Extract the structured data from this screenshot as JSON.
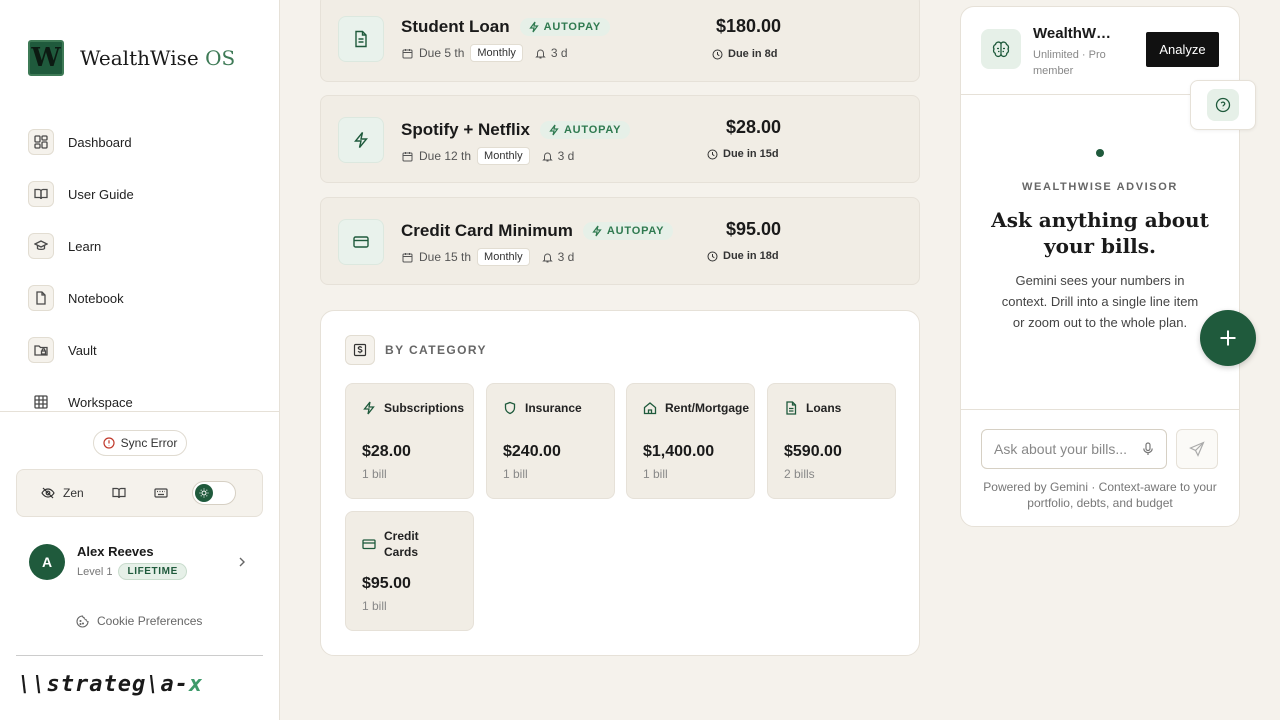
{
  "brand": {
    "logo_letter": "W",
    "name": "WealthWise",
    "suffix": "OS"
  },
  "nav": [
    {
      "label": "Dashboard",
      "icon": "dashboard-icon"
    },
    {
      "label": "User Guide",
      "icon": "book-icon"
    },
    {
      "label": "Learn",
      "icon": "graduation-cap-icon"
    },
    {
      "label": "Notebook",
      "icon": "file-icon"
    },
    {
      "label": "Vault",
      "icon": "folder-lock-icon"
    },
    {
      "label": "Workspace",
      "icon": "grid-icon"
    }
  ],
  "sidebar_footer": {
    "sync_status": "Sync Error",
    "zen_label": "Zen",
    "user": {
      "initial": "A",
      "name": "Alex Reeves",
      "level": "Level 1",
      "badge": "LIFETIME"
    },
    "cookie_label": "Cookie Preferences",
    "footer_logo": {
      "main": "\\\\strateg\\a-",
      "accent": "x"
    }
  },
  "bills": [
    {
      "name": "Student Loan",
      "autopay": "AUTOPAY",
      "due": "Due 5 th",
      "frequency": "Monthly",
      "reminder": "3 d",
      "amount": "$180.00",
      "due_in": "Due in 8d",
      "icon": "document-icon"
    },
    {
      "name": "Spotify + Netflix",
      "autopay": "AUTOPAY",
      "due": "Due 12 th",
      "frequency": "Monthly",
      "reminder": "3 d",
      "amount": "$28.00",
      "due_in": "Due in 15d",
      "icon": "lightning-icon"
    },
    {
      "name": "Credit Card Minimum",
      "autopay": "AUTOPAY",
      "due": "Due 15 th",
      "frequency": "Monthly",
      "reminder": "3 d",
      "amount": "$95.00",
      "due_in": "Due in 18d",
      "icon": "credit-card-icon"
    }
  ],
  "categories": {
    "heading": "BY CATEGORY",
    "items": [
      {
        "name": "Subscriptions",
        "amount": "$28.00",
        "count": "1 bill",
        "icon": "lightning-icon"
      },
      {
        "name": "Insurance",
        "amount": "$240.00",
        "count": "1 bill",
        "icon": "shield-icon"
      },
      {
        "name": "Rent/Mortgage",
        "amount": "$1,400.00",
        "count": "1 bill",
        "icon": "home-icon"
      },
      {
        "name": "Loans",
        "amount": "$590.00",
        "count": "2 bills",
        "icon": "document-icon"
      },
      {
        "name": "Credit Cards",
        "amount": "$95.00",
        "count": "1 bill",
        "icon": "credit-card-icon"
      }
    ]
  },
  "advisor": {
    "name": "WealthWise A...",
    "subtitle": "Unlimited · Pro member",
    "analyze_label": "Analyze",
    "kicker": "WEALTHWISE ADVISOR",
    "title": "Ask anything about your bills.",
    "description": "Gemini sees your numbers in context. Drill into a single line item or zoom out to the whole plan.",
    "input_placeholder": "Ask about your bills...",
    "footer": "Powered by Gemini · Context-aware to your portfolio, debts, and budget"
  },
  "colors": {
    "accent": "#1f5a3c",
    "background": "#f5f2ec",
    "card": "#f1ede5"
  }
}
